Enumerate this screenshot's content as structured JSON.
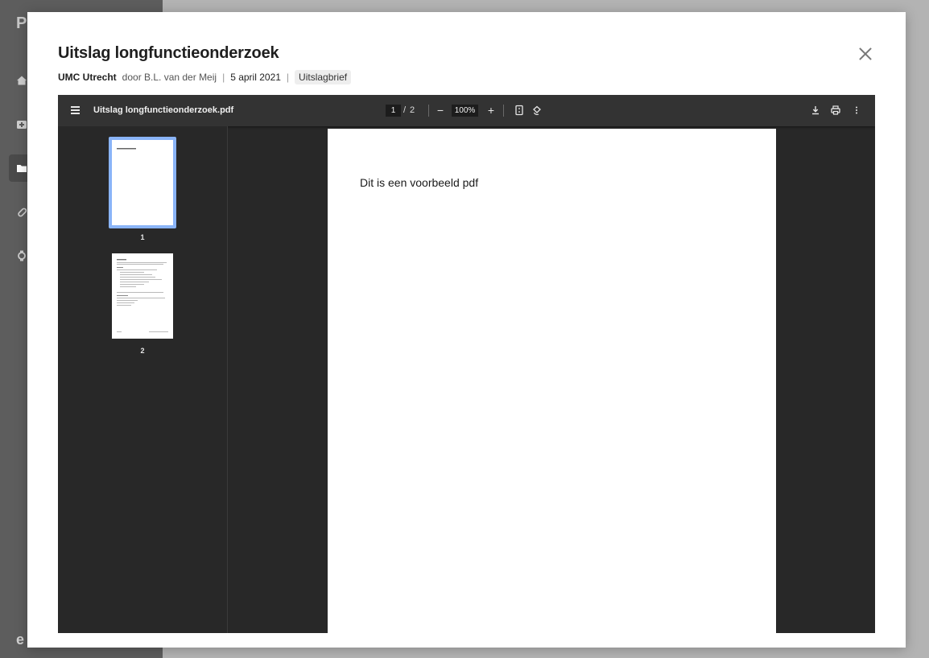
{
  "app": {
    "logo_letter": "P",
    "user_initial": "e",
    "nav_icons": [
      "home-icon",
      "medical-plus-icon",
      "folder-icon",
      "pill-icon",
      "watch-icon"
    ]
  },
  "modal": {
    "title": "Uitslag longfunctieonderzoek",
    "close_label": "×",
    "meta": {
      "organization": "UMC Utrecht",
      "author": "door B.L. van der Meij",
      "separator": "|",
      "date": "5 april 2021",
      "tag": "Uitslagbrief"
    }
  },
  "viewer": {
    "filename": "Uitslag longfunctieonderzoek.pdf",
    "current_page": "1",
    "page_separator": "/",
    "total_pages": "2",
    "zoom": "100%",
    "zoom_out": "−",
    "zoom_in": "+",
    "thumbnails": [
      {
        "number": "1",
        "selected": true
      },
      {
        "number": "2",
        "selected": false
      }
    ],
    "page_text": "Dit is een voorbeeld pdf"
  },
  "colors": {
    "toolbar": "#333333",
    "viewer_bg": "#282828",
    "thumb_selected": "#8ab4f8"
  }
}
